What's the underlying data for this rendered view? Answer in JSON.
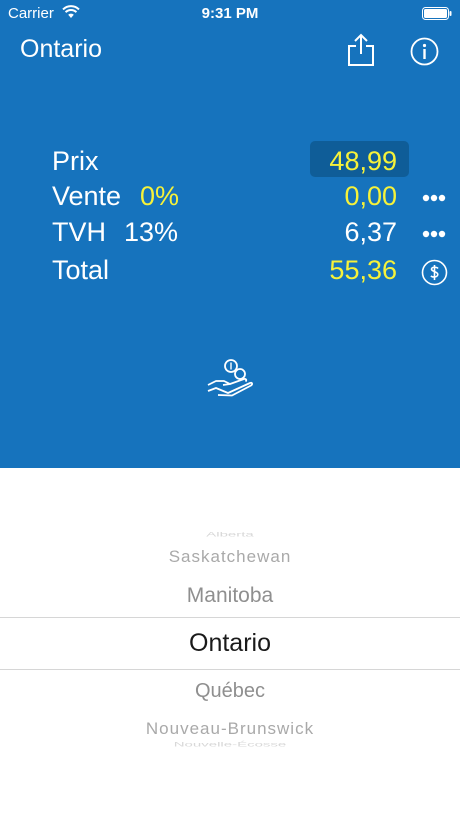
{
  "status_bar": {
    "carrier": "Carrier",
    "time": "9:31 PM"
  },
  "header": {
    "title": "Ontario"
  },
  "calc": {
    "price_label": "Prix",
    "price_value": "48,99",
    "sales_label": "Vente",
    "sales_rate": "0%",
    "sales_value": "0,00",
    "hst_label": "TVH",
    "hst_rate": "13%",
    "hst_value": "6,37",
    "total_label": "Total",
    "total_value": "55,36"
  },
  "picker": {
    "items": [
      "Alberta",
      "Saskatchewan",
      "Manitoba",
      "Ontario",
      "Québec",
      "Nouveau-Brunswick",
      "Nouvelle-Écosse"
    ],
    "selected": "Ontario"
  },
  "colors": {
    "background": "#1673bd",
    "highlight": "#f6f23a",
    "field_bg": "#0f5d98"
  },
  "icons": [
    "wifi-icon",
    "battery-icon",
    "share-icon",
    "info-icon",
    "more-icon",
    "dollar-circle-icon",
    "hand-coin-icon"
  ]
}
